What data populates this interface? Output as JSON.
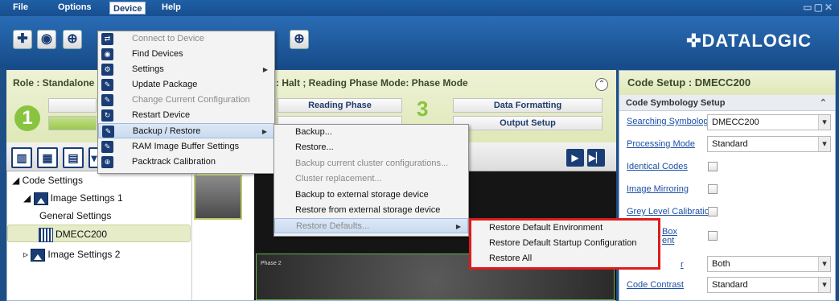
{
  "menubar": {
    "items": [
      "File",
      "Options",
      "Device",
      "Help"
    ],
    "active": "Device"
  },
  "toolbar": {
    "logo": "DATALOGIC"
  },
  "role_bar": {
    "role_text": "Role : Standalone ;",
    "mode_text": ": Halt ; Reading Phase Mode: Phase Mode",
    "step1_num": "1",
    "step3_num": "3",
    "reading_phase": "Reading Phase",
    "data_formatting": "Data Formatting",
    "output_setup": "Output Setup"
  },
  "tree": {
    "code_settings": "Code Settings",
    "image_settings_1": "Image Settings 1",
    "general_settings": "General Settings",
    "dmecc200": "DMECC200",
    "image_settings_2": "Image Settings 2"
  },
  "thumbnails": {
    "thumb1_index": "1",
    "phase2_label": "Phase 2"
  },
  "code_setup": {
    "header": "Code Setup : DMECC200",
    "section": "Code Symbology Setup",
    "rows": [
      {
        "label": "Searching Symbology",
        "value": "DMECC200",
        "type": "select"
      },
      {
        "label": "Processing Mode",
        "value": "Standard",
        "type": "select"
      },
      {
        "label": "Identical Codes",
        "type": "checkbox"
      },
      {
        "label": "Image Mirroring",
        "type": "checkbox"
      },
      {
        "label": "Grey Level Calibration",
        "type": "checkbox"
      },
      {
        "label": "Box",
        "label2": "ent",
        "type": "checkbox"
      },
      {
        "label": "r",
        "value": "Both",
        "type": "select"
      },
      {
        "label": "Code Contrast",
        "value": "Standard",
        "type": "select"
      }
    ]
  },
  "device_menu": {
    "items": [
      {
        "label": "Connect to Device",
        "disabled": true,
        "icon": "connect-icon"
      },
      {
        "label": "Find Devices",
        "disabled": false,
        "icon": "find-devices-icon"
      },
      {
        "label": "Settings",
        "disabled": false,
        "icon": "settings-icon",
        "submenu": true
      },
      {
        "label": "Update Package",
        "disabled": false,
        "icon": "update-package-icon"
      },
      {
        "label": "Change Current Configuration",
        "disabled": true,
        "icon": "change-config-icon"
      },
      {
        "label": "Restart Device",
        "disabled": false,
        "icon": "restart-icon"
      },
      {
        "label": "Backup / Restore",
        "disabled": false,
        "icon": "backup-restore-icon",
        "submenu": true,
        "hover": true
      },
      {
        "label": "RAM Image Buffer Settings",
        "disabled": false,
        "icon": "ram-buffer-icon"
      },
      {
        "label": "Packtrack Calibration",
        "disabled": false,
        "icon": "packtrack-icon"
      }
    ]
  },
  "backup_menu": {
    "items": [
      {
        "label": "Backup...",
        "disabled": false
      },
      {
        "label": "Restore...",
        "disabled": false
      },
      {
        "label": "Backup current cluster configurations...",
        "disabled": true
      },
      {
        "label": "Cluster replacement...",
        "disabled": true
      },
      {
        "label": "Backup to external storage device",
        "disabled": false
      },
      {
        "label": "Restore from external storage device",
        "disabled": false
      },
      {
        "label": "Restore Defaults...",
        "disabled": true,
        "hover": true,
        "submenu": true
      }
    ]
  },
  "defaults_menu": {
    "items": [
      "Restore Default Environment",
      "Restore Default Startup Configuration",
      "Restore All"
    ]
  },
  "colors": {
    "accent": "#1a3d75",
    "highlight_border": "#e01a1a",
    "step_green": "#88c440"
  }
}
